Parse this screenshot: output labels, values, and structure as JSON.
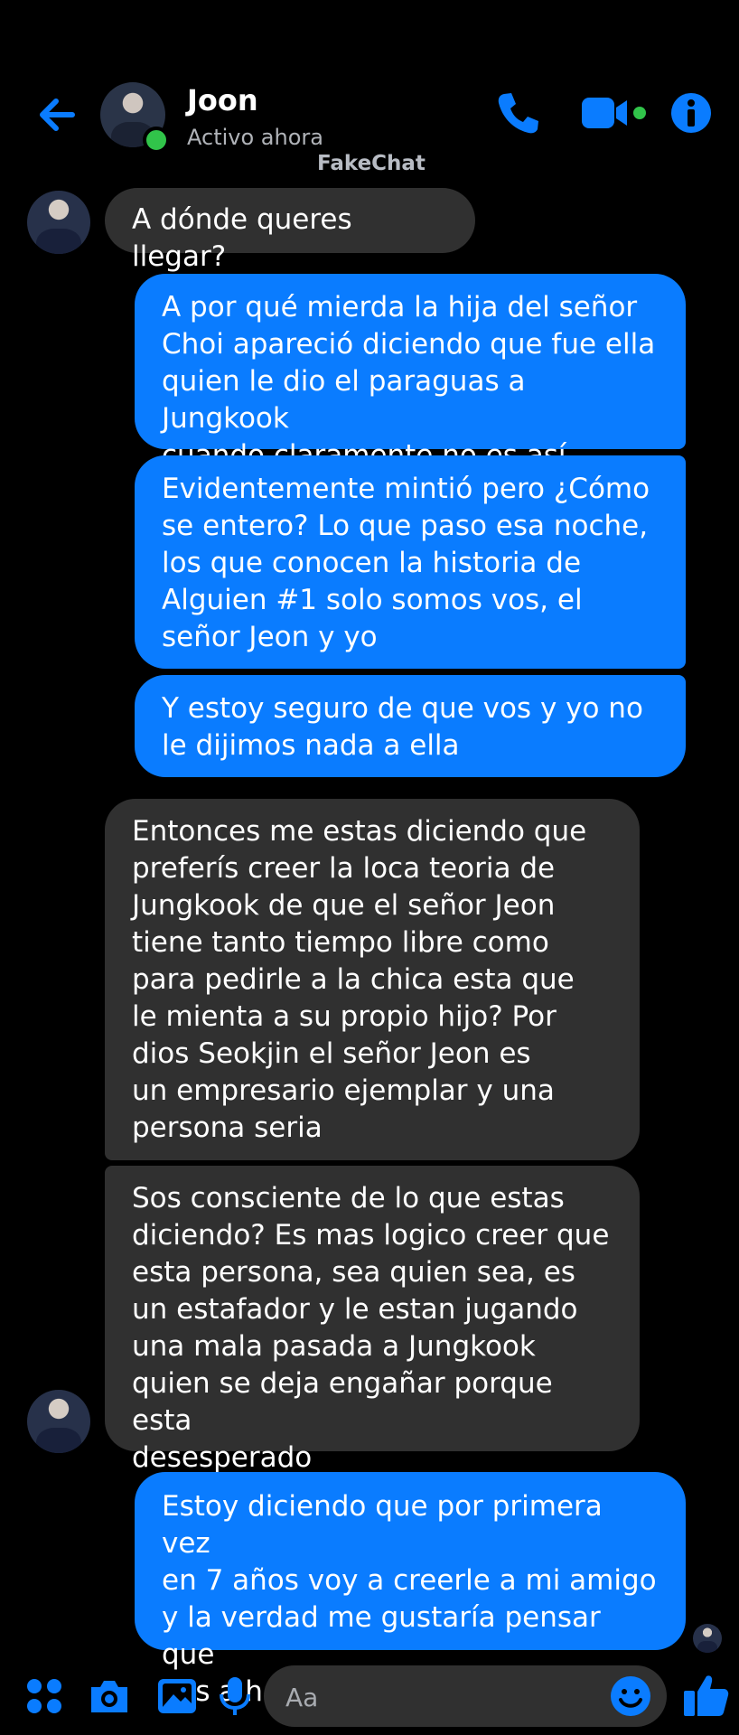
{
  "header": {
    "contact_name": "Joon",
    "status": "Activo ahora",
    "watermark": "FakeChat",
    "icons": [
      "back-arrow-icon",
      "phone-icon",
      "video-camera-icon",
      "info-icon"
    ],
    "accent_color": "#0a7cff",
    "online_color": "#31c44a"
  },
  "messages": [
    {
      "from": "contact",
      "text": "A dónde queres llegar?"
    },
    {
      "from": "me",
      "text": "A por qué mierda la hija del señor\nChoi apareció diciendo que fue ella\nquien le dio el paraguas a Jungkook\ncuando claramente no es así"
    },
    {
      "from": "me",
      "text": "Evidentemente mintió pero ¿Cómo\nse entero? Lo que paso esa noche,\nlos que conocen la historia de\nAlguien #1 solo somos vos, el\nseñor Jeon y yo"
    },
    {
      "from": "me",
      "text": "Y estoy seguro de que vos y yo no\nle dijimos nada a ella"
    },
    {
      "from": "contact",
      "text": "Entonces me estas diciendo que\npreferís creer la loca teoria de\nJungkook de que el señor Jeon\ntiene tanto tiempo libre como\npara pedirle a la chica esta que\nle mienta a su propio hijo? Por\ndios Seokjin el señor Jeon es\nun empresario ejemplar y una\npersona seria"
    },
    {
      "from": "contact",
      "text": "Sos consciente de lo que estas\ndiciendo? Es mas logico creer que\nesta persona, sea quien sea, es\nun estafador y le estan jugando\nuna mala pasada a Jungkook\nquien se deja engañar porque esta\ndesesperado"
    },
    {
      "from": "me",
      "text": "Estoy diciendo que por primera vez\nen 7 años voy a creerle a mi amigo\ny la verdad me gustaría pensar que\nvas a hacer lo mismo"
    }
  ],
  "composer": {
    "placeholder": "Aa",
    "icons": [
      "grid-menu-icon",
      "camera-icon",
      "gallery-icon",
      "microphone-icon",
      "emoji-icon",
      "thumbs-up-icon"
    ]
  },
  "colors": {
    "background": "#000000",
    "incoming_bubble": "#303030",
    "outgoing_bubble": "#0a7cff"
  }
}
